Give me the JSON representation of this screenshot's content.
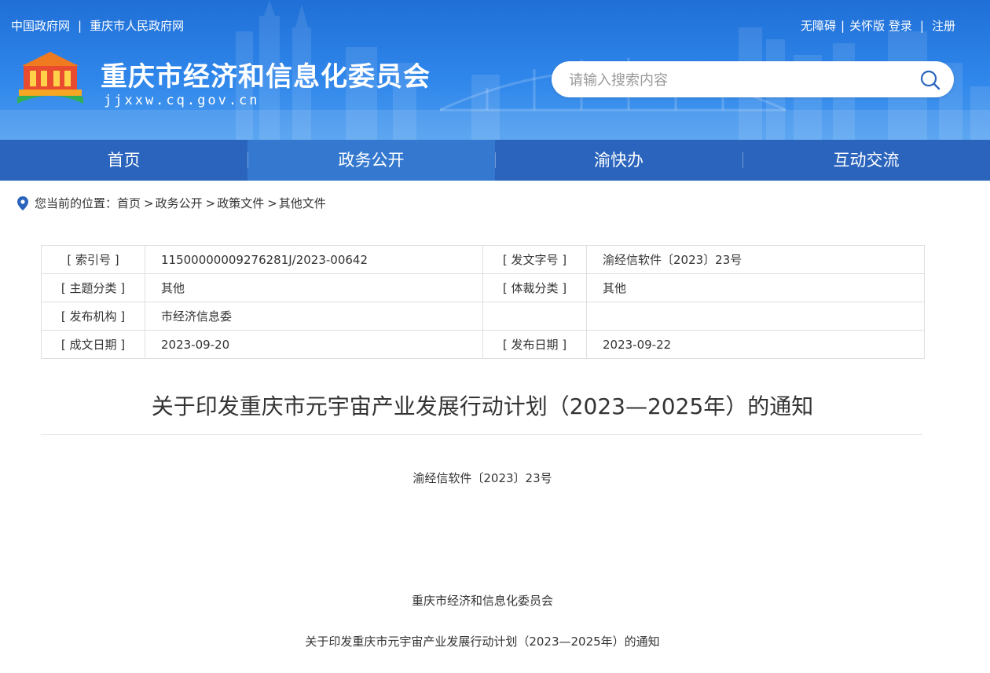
{
  "header": {
    "top_links_left": [
      "中国政府网",
      "重庆市人民政府网"
    ],
    "top_links_right": [
      "无障碍",
      "关怀版",
      "登录",
      "注册"
    ],
    "site_title": "重庆市经济和信息化委员会",
    "site_domain": "jjxxw.cq.gov.cn",
    "search_placeholder": "请输入搜索内容"
  },
  "nav": {
    "items": [
      "首页",
      "政务公开",
      "渝快办",
      "互动交流"
    ],
    "active": "政务公开"
  },
  "breadcrumb": {
    "label": "您当前的位置：",
    "items": [
      "首页",
      "政务公开",
      "政策文件",
      "其他文件"
    ]
  },
  "meta": {
    "index_no_label": "[ 索引号 ]",
    "index_no": "11500000009276281J/2023-00642",
    "doc_no_label": "[ 发文字号 ]",
    "doc_no": "渝经信软件〔2023〕23号",
    "topic_label": "[ 主题分类 ]",
    "topic": "其他",
    "genre_label": "[ 体裁分类 ]",
    "genre": "其他",
    "issuer_label": "[ 发布机构 ]",
    "issuer": "市经济信息委",
    "created_label": "[ 成文日期 ]",
    "created": "2023-09-20",
    "published_label": "[ 发布日期 ]",
    "published": "2023-09-22"
  },
  "document": {
    "title": "关于印发重庆市元宇宙产业发展行动计划（2023—2025年）的通知",
    "doc_number": "渝经信软件〔2023〕23号",
    "issuer": "重庆市经济和信息化委员会",
    "subtitle": "关于印发重庆市元宇宙产业发展行动计划（2023—2025年）的通知"
  },
  "colors": {
    "header_blue": "#2f86ea",
    "nav_blue": "#2a64bd",
    "nav_active": "#3479cf"
  }
}
